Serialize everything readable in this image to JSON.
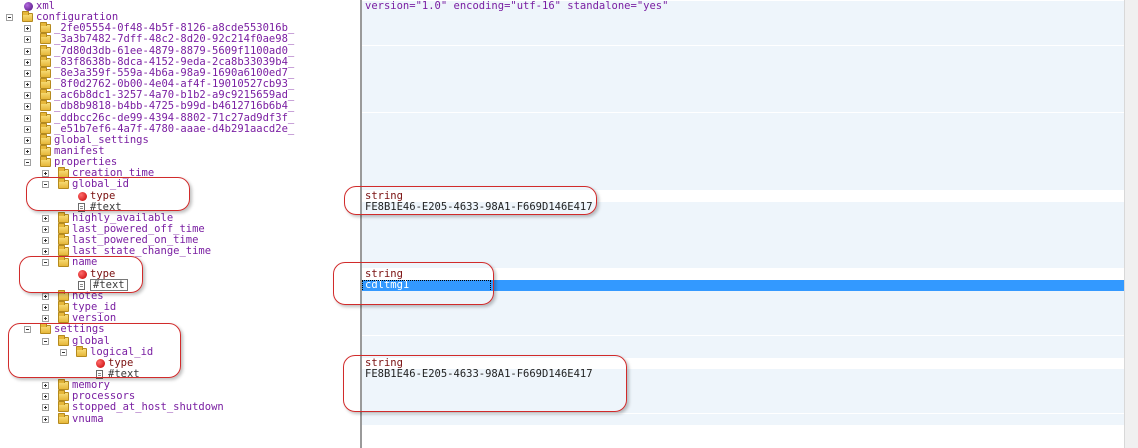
{
  "tree": [
    {
      "label": "xml",
      "icon": "pi",
      "toggle": "none"
    },
    {
      "label": "configuration",
      "icon": "folder",
      "toggle": "minus"
    },
    {
      "label": "_2fe05554-0f48-4b5f-8126-a8cde553016b_",
      "icon": "folder",
      "toggle": "plus"
    },
    {
      "label": "_3a3b7482-7dff-48c2-8d20-92c214f0ae98_",
      "icon": "folder",
      "toggle": "plus"
    },
    {
      "label": "_7d80d3db-61ee-4879-8879-5609f1100ad0_",
      "icon": "folder",
      "toggle": "plus"
    },
    {
      "label": "_83f8638b-8dca-4152-9eda-2ca8b33039b4_",
      "icon": "folder",
      "toggle": "plus"
    },
    {
      "label": "_8e3a359f-559a-4b6a-98a9-1690a6100ed7_",
      "icon": "folder",
      "toggle": "plus"
    },
    {
      "label": "_8f0d2762-0b00-4e04-af4f-19010527cb93_",
      "icon": "folder",
      "toggle": "plus"
    },
    {
      "label": "_ac6b8dc1-3257-4a70-b1b2-a9c9215659ad_",
      "icon": "folder",
      "toggle": "plus"
    },
    {
      "label": "_db8b9818-b4bb-4725-b99d-b4612716b6b4_",
      "icon": "folder",
      "toggle": "plus"
    },
    {
      "label": "_ddbcc26c-de99-4394-8802-71c27ad9df3f_",
      "icon": "folder",
      "toggle": "plus"
    },
    {
      "label": "_e51b7ef6-4a7f-4780-aaae-d4b291aacd2e_",
      "icon": "folder",
      "toggle": "plus"
    },
    {
      "label": "global_settings",
      "icon": "folder",
      "toggle": "plus"
    },
    {
      "label": "manifest",
      "icon": "folder",
      "toggle": "plus"
    },
    {
      "label": "properties",
      "icon": "folder",
      "toggle": "minus"
    },
    {
      "label": "creation_time",
      "icon": "folder",
      "toggle": "plus"
    },
    {
      "label": "global_id",
      "icon": "folder",
      "toggle": "minus"
    },
    {
      "label": "type",
      "icon": "attr",
      "toggle": "none"
    },
    {
      "label": "#text",
      "icon": "text",
      "toggle": "none"
    },
    {
      "label": "highly_available",
      "icon": "folder",
      "toggle": "plus"
    },
    {
      "label": "last_powered_off_time",
      "icon": "folder",
      "toggle": "plus"
    },
    {
      "label": "last_powered_on_time",
      "icon": "folder",
      "toggle": "plus"
    },
    {
      "label": "last_state_change_time",
      "icon": "folder",
      "toggle": "plus"
    },
    {
      "label": "name",
      "icon": "folder",
      "toggle": "minus"
    },
    {
      "label": "type",
      "icon": "attr",
      "toggle": "none"
    },
    {
      "label": "#text",
      "icon": "text",
      "toggle": "none",
      "selected": true
    },
    {
      "label": "notes",
      "icon": "folder",
      "toggle": "plus"
    },
    {
      "label": "type_id",
      "icon": "folder",
      "toggle": "plus"
    },
    {
      "label": "version",
      "icon": "folder",
      "toggle": "plus"
    },
    {
      "label": "settings",
      "icon": "folder",
      "toggle": "minus"
    },
    {
      "label": "global",
      "icon": "folder",
      "toggle": "minus"
    },
    {
      "label": "logical_id",
      "icon": "folder",
      "toggle": "minus"
    },
    {
      "label": "type",
      "icon": "attr",
      "toggle": "none"
    },
    {
      "label": "#text",
      "icon": "text",
      "toggle": "none"
    },
    {
      "label": "memory",
      "icon": "folder",
      "toggle": "plus"
    },
    {
      "label": "processors",
      "icon": "folder",
      "toggle": "plus"
    },
    {
      "label": "stopped_at_host_shutdown",
      "icon": "folder",
      "toggle": "plus"
    },
    {
      "label": "vnuma",
      "icon": "folder",
      "toggle": "plus"
    }
  ],
  "values": [
    {
      "text": "version=\"1.0\" encoding=\"utf-16\" standalone=\"yes\"",
      "style": "purple"
    },
    {
      "text": "",
      "style": ""
    },
    {
      "text": "",
      "style": ""
    },
    {
      "text": "",
      "style": ""
    },
    {
      "text": "",
      "style": ""
    },
    {
      "text": "",
      "style": ""
    },
    {
      "text": "",
      "style": ""
    },
    {
      "text": "",
      "style": ""
    },
    {
      "text": "",
      "style": ""
    },
    {
      "text": "",
      "style": ""
    },
    {
      "text": "",
      "style": ""
    },
    {
      "text": "",
      "style": ""
    },
    {
      "text": "",
      "style": ""
    },
    {
      "text": "",
      "style": ""
    },
    {
      "text": "",
      "style": ""
    },
    {
      "text": "",
      "style": ""
    },
    {
      "text": "",
      "style": ""
    },
    {
      "text": "string",
      "style": "red"
    },
    {
      "text": "FE8B1E46-E205-4633-98A1-F669D146E417",
      "style": ""
    },
    {
      "text": "",
      "style": ""
    },
    {
      "text": "",
      "style": ""
    },
    {
      "text": "",
      "style": ""
    },
    {
      "text": "",
      "style": ""
    },
    {
      "text": "",
      "style": ""
    },
    {
      "text": "string",
      "style": "red"
    },
    {
      "text": "cdltmg1",
      "style": "",
      "selected": true
    },
    {
      "text": "",
      "style": ""
    },
    {
      "text": "",
      "style": ""
    },
    {
      "text": "",
      "style": ""
    },
    {
      "text": "",
      "style": ""
    },
    {
      "text": "",
      "style": ""
    },
    {
      "text": "",
      "style": ""
    },
    {
      "text": "string",
      "style": "red"
    },
    {
      "text": "FE8B1E46-E205-4633-98A1-F669D146E417",
      "style": ""
    },
    {
      "text": "",
      "style": ""
    },
    {
      "text": "",
      "style": ""
    },
    {
      "text": "",
      "style": ""
    },
    {
      "text": "",
      "style": ""
    }
  ],
  "colors": {
    "selection": "#3399ff",
    "band_a": "#eef5fb",
    "band_b": "#ffffff",
    "callout": "#d12b2b",
    "element_text": "#7a1fa2"
  }
}
